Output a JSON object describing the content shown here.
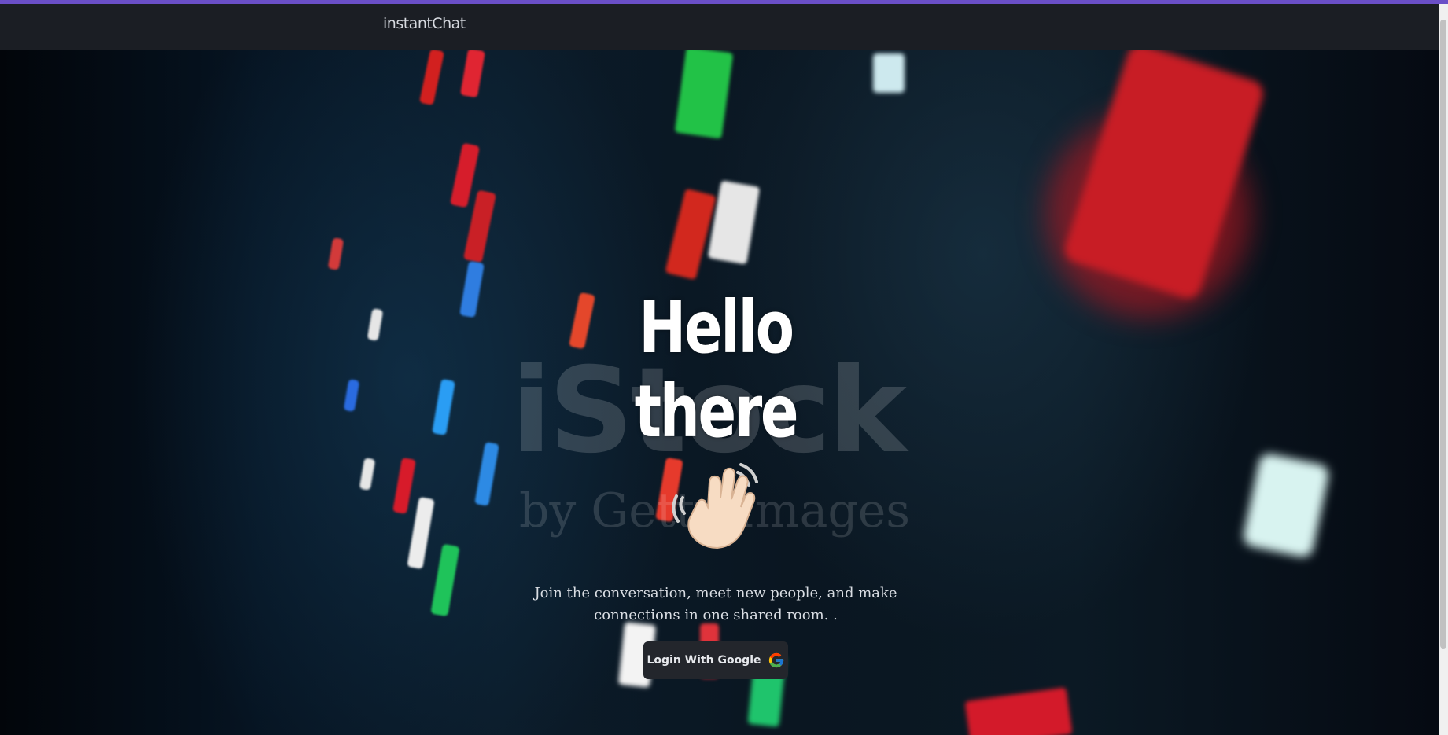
{
  "navbar": {
    "brand": "instantChat"
  },
  "hero": {
    "headline": "Hello there",
    "wave_emoji": "waving-hand-icon",
    "tagline": "Join the conversation, meet new people, and make connections in one shared room. .",
    "watermark_main": "iStock",
    "watermark_sub": "by Getty Images"
  },
  "login": {
    "label": "Login With Google",
    "icon": "google-icon"
  },
  "colors": {
    "accent": "#6a4fc7",
    "navbar_bg": "#1b1e24",
    "button_bg": "#23262c",
    "text": "#d9dde3"
  }
}
